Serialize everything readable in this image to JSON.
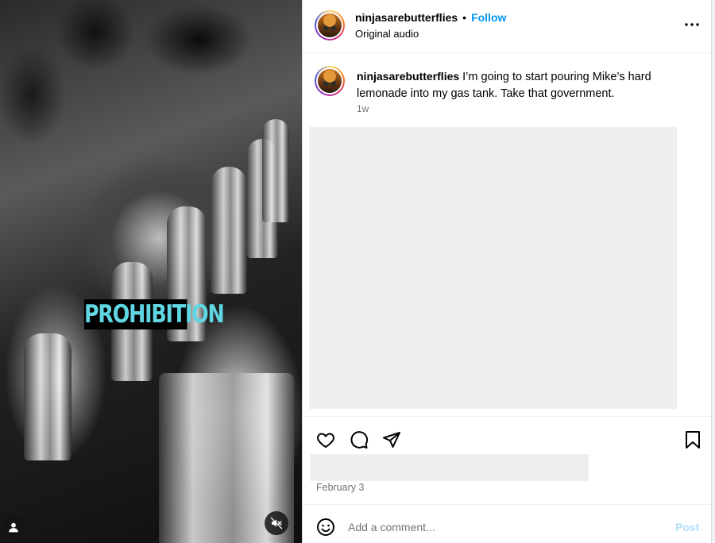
{
  "media": {
    "overlay_text": "PROHIBITION",
    "icons": {
      "user_tag": "person-icon",
      "mute": "speaker-muted-icon"
    }
  },
  "header": {
    "username": "ninjasarebutterflies",
    "separator": "•",
    "follow_label": "Follow",
    "audio_label": "Original audio",
    "more_icon": "more-horizontal-icon"
  },
  "caption": {
    "username": "ninjasarebutterflies",
    "text": "I’m going to start pouring Mike’s hard lemonade into my gas tank. Take that government.",
    "time": "1w"
  },
  "actions": {
    "icons": [
      "heart-icon",
      "comment-bubble-icon",
      "send-paper-plane-icon",
      "bookmark-icon"
    ]
  },
  "post_date": "February 3",
  "comment_bar": {
    "placeholder": "Add a comment...",
    "post_label": "Post",
    "emoji_icon": "smiley-icon"
  },
  "colors": {
    "link_blue": "#0095f6",
    "post_disabled": "#b2dffc",
    "secondary_text": "#737373",
    "caption_overlay_text": "#5fd6e2"
  }
}
